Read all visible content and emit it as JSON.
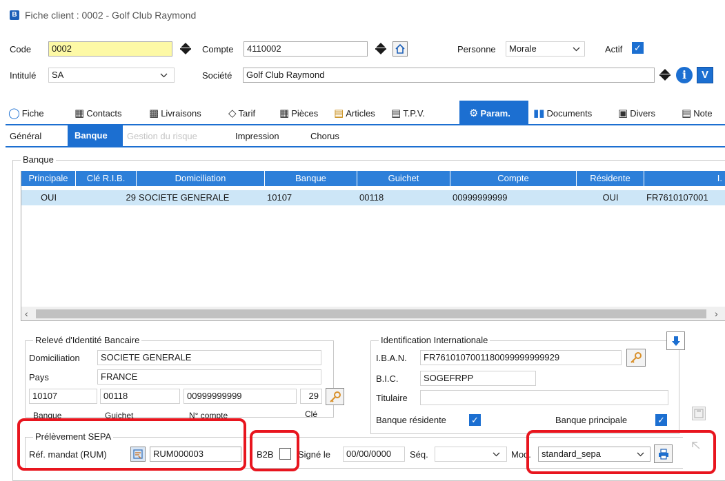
{
  "window": {
    "title": "Fiche client : 0002 - Golf Club Raymond"
  },
  "header": {
    "code_label": "Code",
    "code_value": "0002",
    "compte_label": "Compte",
    "compte_value": "4110002",
    "personne_label": "Personne",
    "personne_value": "Morale",
    "actif_label": "Actif",
    "intitule_label": "Intitulé",
    "intitule_value": "SA",
    "societe_label": "Société",
    "societe_value": "Golf Club Raymond"
  },
  "tabs": [
    {
      "label": "Fiche",
      "icon": "person-icon"
    },
    {
      "label": "Contacts",
      "icon": "contacts-icon"
    },
    {
      "label": "Livraisons",
      "icon": "delivery-icon"
    },
    {
      "label": "Tarif",
      "icon": "tag-icon"
    },
    {
      "label": "Pièces",
      "icon": "grid-icon"
    },
    {
      "label": "Articles",
      "icon": "articles-icon"
    },
    {
      "label": "T.P.V.",
      "icon": "register-icon"
    },
    {
      "label": "Param.",
      "icon": "gear-icon"
    },
    {
      "label": "Documents",
      "icon": "bars-icon"
    },
    {
      "label": "Divers",
      "icon": "divers-icon"
    },
    {
      "label": "Note",
      "icon": "note-icon"
    }
  ],
  "subtabs": [
    "Général",
    "Banque",
    "Gestion du risque",
    "Impression",
    "Chorus"
  ],
  "banque": {
    "group_title": "Banque",
    "columns": [
      "Principale",
      "Clé R.I.B.",
      "Domiciliation",
      "Banque",
      "Guichet",
      "Compte",
      "Résidente",
      "I."
    ],
    "rows": [
      {
        "principale": "OUI",
        "cle": "29",
        "domiciliation": "SOCIETE GENERALE",
        "banque": "10107",
        "guichet": "00118",
        "compte": "00999999999",
        "residente": "OUI",
        "iban": "FR7610107001"
      }
    ]
  },
  "rib": {
    "group_title": "Relevé d'Identité Bancaire",
    "domiciliation_label": "Domiciliation",
    "domiciliation_value": "SOCIETE GENERALE",
    "pays_label": "Pays",
    "pays_value": "FRANCE",
    "banque_value": "10107",
    "guichet_value": "00118",
    "compte_value": "00999999999",
    "cle_value": "29",
    "banque_label": "Banque",
    "guichet_label": "Guichet",
    "compte_label": "N° compte",
    "cle_label": "Clé"
  },
  "intl": {
    "group_title": "Identification Internationale",
    "iban_label": "I.B.A.N.",
    "iban_value": "FR7610107001180099999999929",
    "bic_label": "B.I.C.",
    "bic_value": "SOGEFRPP",
    "titulaire_label": "Titulaire",
    "titulaire_value": "",
    "residente_label": "Banque résidente",
    "principale_label": "Banque principale"
  },
  "sepa": {
    "group_title": "Prélèvement SEPA",
    "rum_label": "Réf. mandat (RUM)",
    "rum_value": "RUM000003",
    "b2b_label": "B2B",
    "signe_label": "Signé le",
    "signe_value": "00/00/0000",
    "seq_label": "Séq.",
    "seq_value": "",
    "mod_label": "Mod.",
    "mod_value": "standard_sepa"
  },
  "colors": {
    "accent": "#1c6fd1",
    "highlight_field": "#fdf9a6",
    "selected_row": "#cde6f7",
    "annotation": "#e8151e"
  }
}
